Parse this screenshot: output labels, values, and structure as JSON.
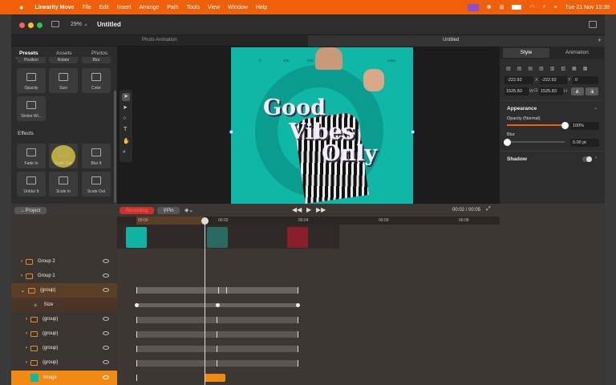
{
  "menubar": {
    "app_name": "Linearity Move",
    "menus": [
      "File",
      "Edit",
      "Insert",
      "Arrange",
      "Path",
      "Tools",
      "View",
      "Window",
      "Help"
    ],
    "clock": "Tue 21 Nov  15:38"
  },
  "window": {
    "title": "Untitled",
    "zoom": "29%",
    "tabs": [
      "Photo Animation",
      "Untitled"
    ]
  },
  "left_panel": {
    "tabs": [
      "Presets",
      "Assets",
      "Photos"
    ],
    "partial_row": [
      "Position",
      "Rotate",
      "Blur"
    ],
    "presets": [
      "Opacity",
      "Size",
      "Color",
      "Stroke Wi..."
    ],
    "effects_header": "Effects",
    "effects": [
      "Fade In",
      "Fade Out",
      "Blur It",
      "Unblur It",
      "Scale In",
      "Scale Out"
    ]
  },
  "right_panel": {
    "tabs": [
      "Style",
      "Animation"
    ],
    "x": "-222.92",
    "x_label": "X",
    "y": "-222.92",
    "y_label": "Y",
    "angle": "0",
    "w": "1525.83",
    "w_label": "W",
    "h": "1525.83",
    "h_label": "H",
    "appearance": "Appearance",
    "opacity_mode": "Opacity (Normal)",
    "opacity_value": "100%",
    "opacity_level": 1.0,
    "blur_label": "Blur",
    "blur_value": "0.00 pt",
    "blur_level": 0.0,
    "shadow_label": "Shadow"
  },
  "canvas": {
    "ruler_ticks": [
      "0",
      "200",
      "600",
      "1080"
    ],
    "art_text": [
      "Good",
      "Vibes",
      "Only"
    ]
  },
  "bottom": {
    "project_button": "Project",
    "record_button": "Recording",
    "pin_button": "Pin",
    "time": "00:02 / 00:05",
    "ruler": [
      "00:00",
      "00:02",
      "00:04",
      "00:09",
      "00:08"
    ]
  },
  "layers": [
    {
      "name": "Group 2",
      "type": "folder"
    },
    {
      "name": "Group 1",
      "type": "folder"
    },
    {
      "name": "(group)",
      "type": "folder"
    },
    {
      "name": "Size",
      "type": "property"
    },
    {
      "name": "(group)",
      "type": "folder"
    },
    {
      "name": "(group)",
      "type": "folder"
    },
    {
      "name": "(group)",
      "type": "folder"
    },
    {
      "name": "(group)",
      "type": "folder"
    },
    {
      "name": "Image",
      "type": "image"
    }
  ],
  "colors": {
    "accent": "#f0600a",
    "canvas": "#0fb7a6",
    "selected_row": "#5a3e25",
    "image_row": "#f08a12"
  }
}
